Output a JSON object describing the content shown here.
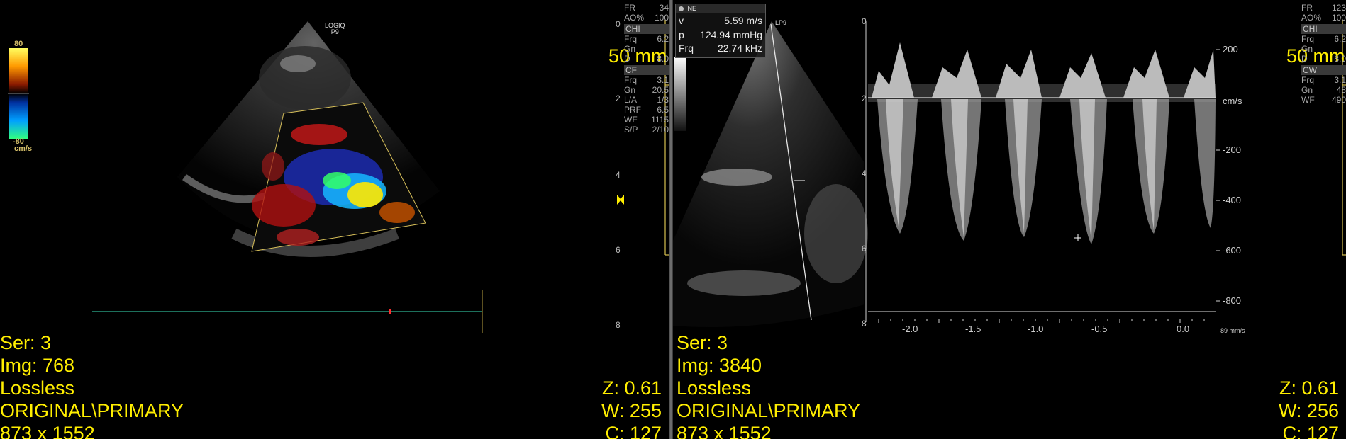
{
  "left": {
    "overlay": {
      "ser": "Ser: 3",
      "img": "Img: 768",
      "compression": "Lossless",
      "type": "ORIGINAL\\PRIMARY",
      "dims": "873 x 1552",
      "zoom": "Z: 0.61",
      "width": "W: 255",
      "center": "C: 127",
      "depth_mm": "50 mm"
    },
    "logo": [
      "LOGIQ",
      "P9"
    ],
    "colorbar": {
      "top": "80",
      "bottom": "-80",
      "unit": "cm/s"
    },
    "depth_ticks": [
      "0",
      "2",
      "4",
      "6",
      "8"
    ],
    "params": {
      "fr": [
        "FR",
        "34"
      ],
      "ao": [
        "AO%",
        "100"
      ],
      "chi_header": "CHI",
      "chi": [
        [
          "Frq",
          "6.2"
        ],
        [
          "Gn",
          ""
        ],
        [
          "D",
          "8.0"
        ]
      ],
      "cf_header": "CF",
      "cf": [
        [
          "Frq",
          "3.1"
        ],
        [
          "Gn",
          "20.5"
        ],
        [
          "L/A",
          "1/3"
        ],
        [
          "PRF",
          "6.5"
        ],
        [
          "WF",
          "1115"
        ],
        [
          "S/P",
          "2/10"
        ]
      ]
    }
  },
  "right": {
    "overlay": {
      "ser": "Ser: 3",
      "img": "Img: 3840",
      "compression": "Lossless",
      "type": "ORIGINAL\\PRIMARY",
      "dims": "873 x 1552",
      "zoom": "Z: 0.61",
      "width": "W: 256",
      "center": "C: 127",
      "depth_mm": "50 mm"
    },
    "measurement": {
      "title": "NE",
      "v_label": "v",
      "v_value": "5.59 m/s",
      "p_label": "p",
      "p_value": "124.94 mmHg",
      "frq_label": "Frq",
      "frq_value": "22.74 kHz"
    },
    "logo": [
      "LP9"
    ],
    "depth_ticks": [
      "0",
      "2",
      "4",
      "6",
      "8"
    ],
    "velocity_scale": {
      "unit": "cm/s",
      "labels": [
        "200",
        "-200",
        "-400",
        "-600",
        "-800"
      ]
    },
    "time_axis": {
      "labels": [
        "-2.0",
        "-1.5",
        "-1.0",
        "-0.5",
        "0.0"
      ],
      "sweep": "89 mm/s"
    },
    "params": {
      "fr": [
        "FR",
        "123"
      ],
      "ao": [
        "AO%",
        "100"
      ],
      "chi_header": "CHI",
      "chi": [
        [
          "Frq",
          "6.2"
        ],
        [
          "Gn",
          ""
        ],
        [
          "D",
          "8.0"
        ]
      ],
      "cw_header": "CW",
      "cw": [
        [
          "Frq",
          "3.1"
        ],
        [
          "Gn",
          "48"
        ],
        [
          "WF",
          "490"
        ]
      ]
    }
  }
}
